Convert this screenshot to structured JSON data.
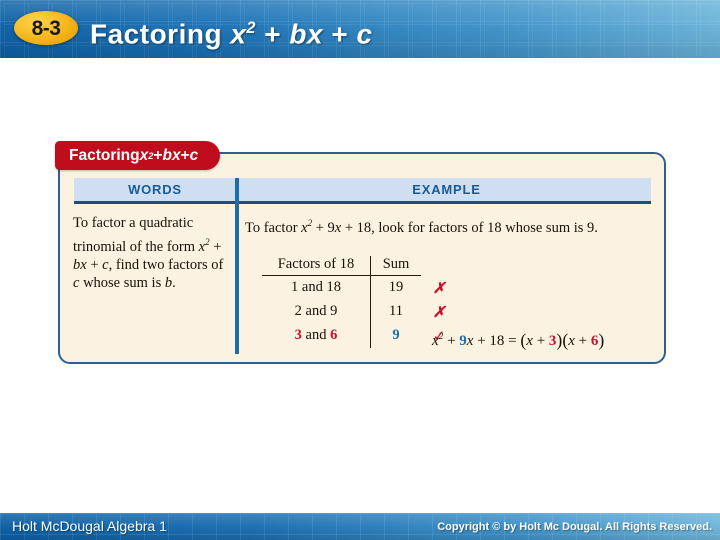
{
  "header": {
    "lesson_number": "8-3",
    "title_prefix": "Factoring ",
    "title_var1": "x",
    "title_exp1": "2",
    "title_mid": " + ",
    "title_var2": "bx",
    "title_mid2": " + ",
    "title_var3": "c",
    "accent_color": "#0b5fa5",
    "badge_color": "#f5b41a"
  },
  "panel": {
    "banner": {
      "prefix": "Factoring ",
      "var1": "x",
      "exp1": "2",
      "mid": "+ ",
      "var2": "bx",
      "mid2": " + ",
      "var3": "c",
      "color": "#c00d1e"
    },
    "columns": {
      "words_label": "WORDS",
      "example_label": "EXAMPLE",
      "label_color": "#1a5a96"
    },
    "words": {
      "line1": "To factor a quadratic",
      "line2": "trinomial of the form",
      "line3_var1": "x",
      "line3_exp1": "2",
      "line3_mid": " + ",
      "line3_var2": "bx",
      "line3_mid2": " + ",
      "line3_var3": "c",
      "line3_tail": ", find two",
      "line4": "factors of ",
      "line4_var": "c",
      "line4_tail": " whose",
      "line5": "sum is ",
      "line5_var": "b",
      "line5_tail": "."
    },
    "example": {
      "intro_prefix": "To factor ",
      "intro_var": "x",
      "intro_exp": "2",
      "intro_mid": " + 9",
      "intro_var2": "x",
      "intro_tail": " + 18, look for factors of 18 whose",
      "intro_line2": "sum is 9.",
      "table": {
        "headers": [
          "Factors of 18",
          "Sum",
          ""
        ],
        "rows": [
          {
            "factors": "1 and 18",
            "factor_a": "1",
            "factor_b": "18",
            "sum": "19",
            "mark": "✗",
            "valid": false
          },
          {
            "factors": "2 and 9",
            "factor_a": "2",
            "factor_b": "9",
            "sum": "11",
            "mark": "✗",
            "valid": false
          },
          {
            "factors": "3 and 6",
            "factor_a": "3",
            "factor_b": "6",
            "sum": "9",
            "mark": "✓",
            "valid": true
          }
        ]
      },
      "equation": {
        "lhs_var": "x",
        "lhs_exp": "2",
        "lhs_plus": " + ",
        "lhs_coef": "9",
        "lhs_var2": "x",
        "lhs_tail": " + 18 = ",
        "f1_open": "(",
        "f1_var": "x",
        "f1_plus": " + ",
        "f1_num": "3",
        "f1_close": ")",
        "f2_open": "(",
        "f2_var": "x",
        "f2_plus": " + ",
        "f2_num": "6",
        "f2_close": ")"
      }
    },
    "highlight_red": "#c8102e",
    "highlight_blue": "#1a6fb0",
    "background": "#fcf2e2",
    "border_color": "#2e5f93"
  },
  "footer": {
    "left_text": "Holt McDougal Algebra 1",
    "right_text": "Copyright © by Holt Mc Dougal. All Rights Reserved."
  }
}
